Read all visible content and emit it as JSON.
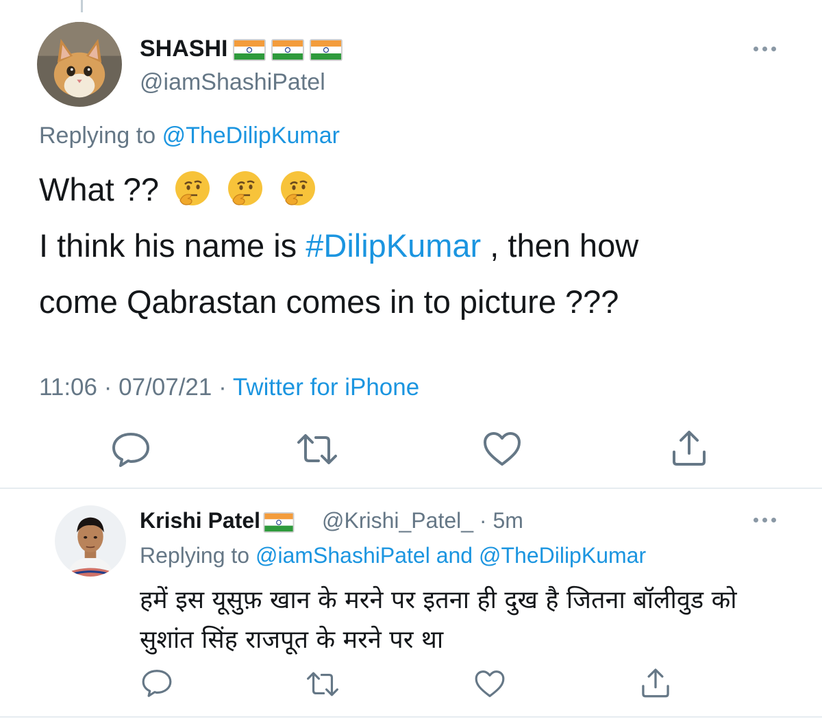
{
  "tweet": {
    "display_name": "SHASHI",
    "handle": "@iamShashiPatel",
    "replying_prefix": "Replying to",
    "replying_to": "@TheDilipKumar",
    "text_line1": "What ??",
    "text_line2_pre": "I think his name is",
    "hashtag": "#DilipKumar",
    "text_line2_post": ", then how",
    "text_line3": "come Qabrastan comes in to picture ???",
    "time": "11:06",
    "date": "07/07/21",
    "source": "Twitter for iPhone",
    "separator": "·"
  },
  "reply": {
    "display_name": "Krishi Patel",
    "handle": "@Krishi_Patel_",
    "age": "· 5m",
    "replying_prefix": "Replying to",
    "replying_to_1": "@iamShashiPatel",
    "replying_and": "and",
    "replying_to_2": "@TheDilipKumar",
    "text_line1": "हमें इस यूसुफ़ खान के मरने पर इतना ही दुख है जितना बॉलीवुड को",
    "text_line2": "सुशांत सिंह राजपूत के मरने पर था"
  },
  "icons": {
    "reply": "reply-icon",
    "retweet": "retweet-icon",
    "like": "heart-icon",
    "share": "share-icon",
    "more": "more-icon",
    "flag": "india-flag-icon",
    "emoji": "thinking-face-emoji"
  },
  "colors": {
    "link": "#1b95e0",
    "secondary": "#657786",
    "text": "#14171a",
    "divider": "#e6ecf0"
  }
}
